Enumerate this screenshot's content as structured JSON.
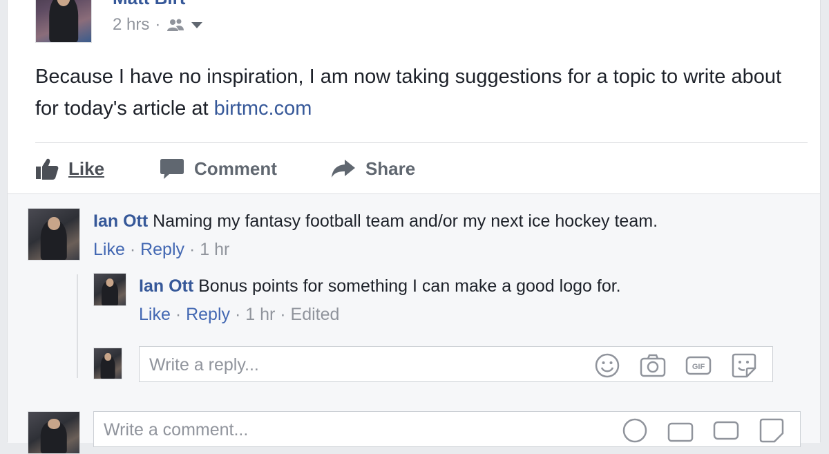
{
  "post": {
    "author": "Matt Birt",
    "time": "2 hrs",
    "separator": "·",
    "audience_icon": "friends-icon",
    "text": "Because I have no inspiration, I am now taking suggestions for a topic to write about for today's article at ",
    "link_text": "birtmc.com"
  },
  "actions": {
    "like": "Like",
    "comment": "Comment",
    "share": "Share"
  },
  "comments": [
    {
      "author": "Ian Ott",
      "text": "Naming my fantasy football team and/or my next ice hockey team.",
      "like": "Like",
      "reply": "Reply",
      "time": "1 hr",
      "replies": [
        {
          "author": "Ian Ott",
          "text": "Bonus points for something I can make a good logo for.",
          "like": "Like",
          "reply": "Reply",
          "time": "1 hr",
          "edited": "Edited"
        }
      ]
    }
  ],
  "reply_input": {
    "placeholder": "Write a reply..."
  },
  "comment_input": {
    "placeholder": "Write a comment..."
  },
  "composer_icons": [
    "emoji-icon",
    "camera-icon",
    "gif-icon",
    "sticker-icon"
  ],
  "colors": {
    "link": "#365899",
    "meta": "#90949c",
    "background": "#e9ebee"
  }
}
